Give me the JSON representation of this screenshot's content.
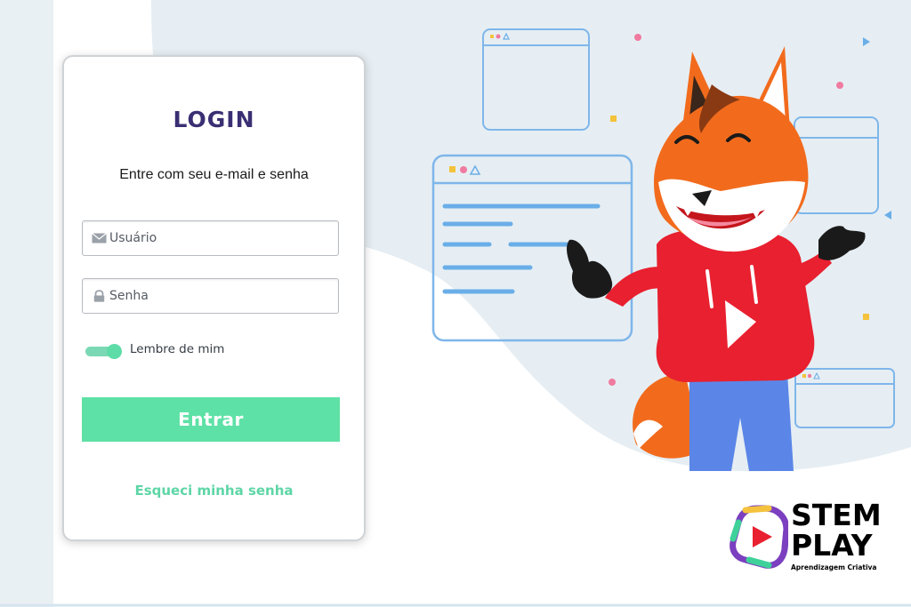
{
  "login": {
    "title": "LOGIN",
    "subtitle": "Entre com seu e-mail e senha",
    "username_placeholder": "Usuário",
    "password_placeholder": "Senha",
    "remember_label": "Lembre de mim",
    "remember_checked": true,
    "submit_label": "Entrar",
    "forgot_label": "Esqueci minha senha"
  },
  "logo": {
    "line1": "STEM",
    "line2": "PLAY",
    "tagline": "Aprendizagem Criativa"
  },
  "colors": {
    "accent_green": "#5ee1a6",
    "title_purple": "#3a2f73",
    "fox_orange": "#f26b1d",
    "hoodie_red": "#e8202f",
    "pants_blue": "#5b86e8",
    "window_blue": "#6aaee8",
    "background_tint": "#e6eef3"
  },
  "icons": [
    "envelope-icon",
    "lock-icon",
    "play-icon"
  ]
}
